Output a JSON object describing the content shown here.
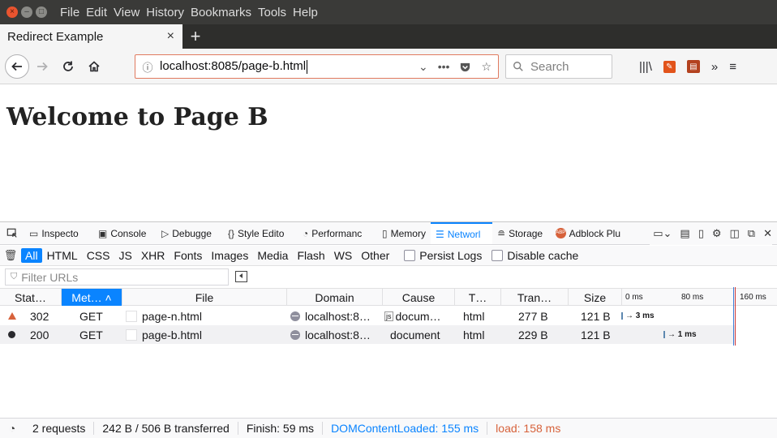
{
  "menubar": {
    "items": [
      "File",
      "Edit",
      "View",
      "History",
      "Bookmarks",
      "Tools",
      "Help"
    ]
  },
  "tab": {
    "title": "Redirect Example",
    "close": "×",
    "new": "+"
  },
  "navbar": {
    "url": "localhost:8085/page-b.html",
    "search_placeholder": "Search",
    "overflow": "»",
    "page_actions": "•••"
  },
  "page": {
    "heading": "Welcome to Page B"
  },
  "devtools": {
    "tabs": [
      "Inspecto",
      "Console",
      "Debugge",
      "Style Edito",
      "Performanc",
      "Memory",
      "Networl",
      "Storage",
      "Adblock Plu"
    ],
    "active_tab_index": 6,
    "filters": [
      "All",
      "HTML",
      "CSS",
      "JS",
      "XHR",
      "Fonts",
      "Images",
      "Media",
      "Flash",
      "WS",
      "Other"
    ],
    "active_filter_index": 0,
    "persist_logs": "Persist Logs",
    "disable_cache": "Disable cache",
    "filter_placeholder": "Filter URLs",
    "columns": {
      "status": "Stat…",
      "method": "Met… ˄",
      "file": "File",
      "domain": "Domain",
      "cause": "Cause",
      "type": "T…",
      "transferred": "Tran…",
      "size": "Size",
      "t0": "0 ms",
      "t80": "80 ms",
      "t160": "160 ms"
    },
    "rows": [
      {
        "status": "302",
        "status_kind": "redirect",
        "method": "GET",
        "file": "page-n.html",
        "domain": "localhost:8…",
        "cause": "docum…",
        "type": "html",
        "transferred": "277 B",
        "size": "121 B",
        "timing": "→ 3 ms",
        "timing_start_ms": 0
      },
      {
        "status": "200",
        "status_kind": "ok",
        "method": "GET",
        "file": "page-b.html",
        "domain": "localhost:8…",
        "cause": "document",
        "type": "html",
        "transferred": "229 B",
        "size": "121 B",
        "timing": "→ 1 ms",
        "timing_start_ms": 58
      }
    ],
    "status": {
      "requests": "2 requests",
      "transferred": "242 B / 506 B transferred",
      "finish": "Finish: 59 ms",
      "dom_content_loaded": "DOMContentLoaded: 155 ms",
      "load": "load: 158 ms"
    }
  },
  "colors": {
    "accent": "#0a84ff",
    "redirect": "#d7623b",
    "urlbar_border": "#e07a5f"
  }
}
